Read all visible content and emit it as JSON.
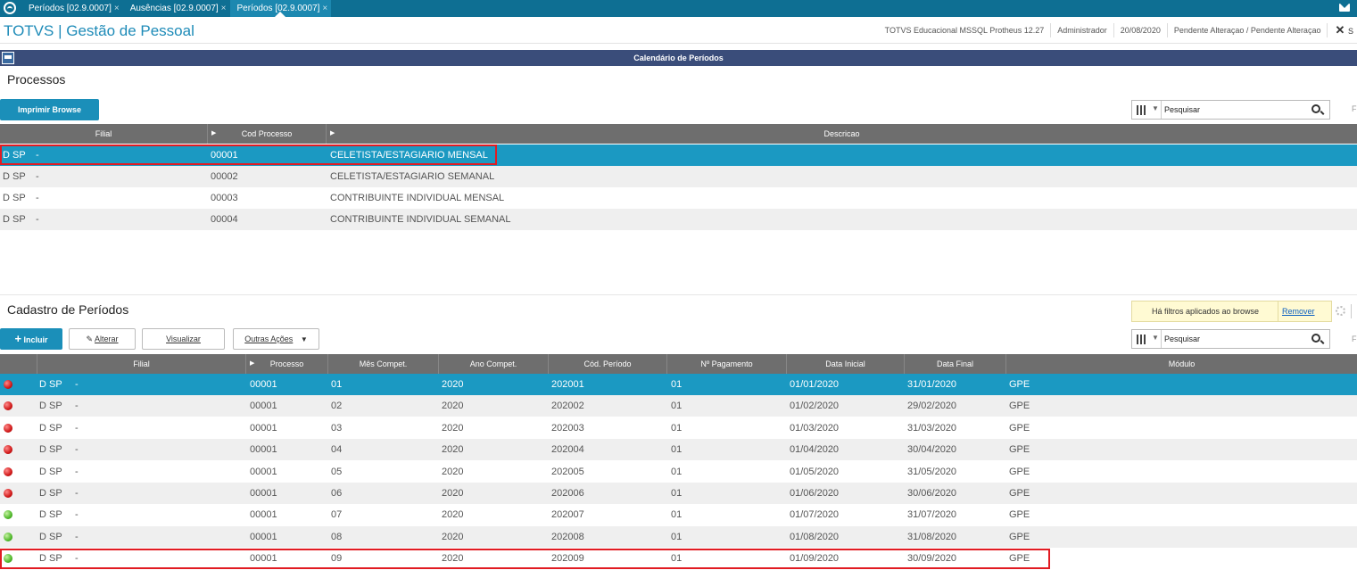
{
  "tabs": [
    {
      "label": "Períodos [02.9.0007]",
      "close": "×"
    },
    {
      "label": "Ausências [02.9.0007]",
      "close": "×"
    },
    {
      "label": "Períodos [02.9.0007]",
      "close": "×"
    }
  ],
  "app": {
    "title": "TOTVS | Gestão de Pessoal",
    "environment": "TOTVS Educacional MSSQL Protheus 12.27",
    "user": "Administrador",
    "date": "20/08/2020",
    "status": "Pendente Alteraçao / Pendente Alteraçao",
    "close": "✕",
    "truncated": "S"
  },
  "window": {
    "title": "Calendário de Períodos"
  },
  "processos": {
    "title": "Processos",
    "print_button": "Imprimir Browse",
    "search_placeholder": "Pesquisar",
    "truncated": "F",
    "columns": [
      "Filial",
      "Cod Processo",
      "Descricao"
    ],
    "rows": [
      {
        "filial": "D SP",
        "dash": "-",
        "cod": "00001",
        "desc": "CELETISTA/ESTAGIARIO MENSAL"
      },
      {
        "filial": "D SP",
        "dash": "-",
        "cod": "00002",
        "desc": "CELETISTA/ESTAGIARIO SEMANAL"
      },
      {
        "filial": "D SP",
        "dash": "-",
        "cod": "00003",
        "desc": "CONTRIBUINTE INDIVIDUAL MENSAL"
      },
      {
        "filial": "D SP",
        "dash": "-",
        "cod": "00004",
        "desc": "CONTRIBUINTE INDIVIDUAL SEMANAL"
      }
    ]
  },
  "periodos": {
    "title": "Cadastro de Períodos",
    "buttons": {
      "incluir": "Incluir",
      "alterar": "Alterar",
      "visualizar": "Visualizar",
      "outras": "Outras Ações"
    },
    "filter_text": "Há filtros aplicados ao browse",
    "filter_link": "Remover",
    "search_placeholder": "Pesquisar",
    "truncated": "F",
    "columns": [
      "Filial",
      "Processo",
      "Mês Compet.",
      "Ano Compet.",
      "Cód. Período",
      "Nº Pagamento",
      "Data Inicial",
      "Data Final",
      "Módulo"
    ],
    "rows": [
      {
        "status": "red",
        "filial": "D SP",
        "dash": "-",
        "processo": "00001",
        "mes": "01",
        "ano": "2020",
        "periodo": "202001",
        "pagamento": "01",
        "inicio": "01/01/2020",
        "fim": "31/01/2020",
        "modulo": "GPE"
      },
      {
        "status": "red",
        "filial": "D SP",
        "dash": "-",
        "processo": "00001",
        "mes": "02",
        "ano": "2020",
        "periodo": "202002",
        "pagamento": "01",
        "inicio": "01/02/2020",
        "fim": "29/02/2020",
        "modulo": "GPE"
      },
      {
        "status": "red",
        "filial": "D SP",
        "dash": "-",
        "processo": "00001",
        "mes": "03",
        "ano": "2020",
        "periodo": "202003",
        "pagamento": "01",
        "inicio": "01/03/2020",
        "fim": "31/03/2020",
        "modulo": "GPE"
      },
      {
        "status": "red",
        "filial": "D SP",
        "dash": "-",
        "processo": "00001",
        "mes": "04",
        "ano": "2020",
        "periodo": "202004",
        "pagamento": "01",
        "inicio": "01/04/2020",
        "fim": "30/04/2020",
        "modulo": "GPE"
      },
      {
        "status": "red",
        "filial": "D SP",
        "dash": "-",
        "processo": "00001",
        "mes": "05",
        "ano": "2020",
        "periodo": "202005",
        "pagamento": "01",
        "inicio": "01/05/2020",
        "fim": "31/05/2020",
        "modulo": "GPE"
      },
      {
        "status": "red",
        "filial": "D SP",
        "dash": "-",
        "processo": "00001",
        "mes": "06",
        "ano": "2020",
        "periodo": "202006",
        "pagamento": "01",
        "inicio": "01/06/2020",
        "fim": "30/06/2020",
        "modulo": "GPE"
      },
      {
        "status": "green",
        "filial": "D SP",
        "dash": "-",
        "processo": "00001",
        "mes": "07",
        "ano": "2020",
        "periodo": "202007",
        "pagamento": "01",
        "inicio": "01/07/2020",
        "fim": "31/07/2020",
        "modulo": "GPE"
      },
      {
        "status": "green",
        "filial": "D SP",
        "dash": "-",
        "processo": "00001",
        "mes": "08",
        "ano": "2020",
        "periodo": "202008",
        "pagamento": "01",
        "inicio": "01/08/2020",
        "fim": "31/08/2020",
        "modulo": "GPE"
      },
      {
        "status": "green",
        "filial": "D SP",
        "dash": "-",
        "processo": "00001",
        "mes": "09",
        "ano": "2020",
        "periodo": "202009",
        "pagamento": "01",
        "inicio": "01/09/2020",
        "fim": "30/09/2020",
        "modulo": "GPE"
      }
    ]
  }
}
